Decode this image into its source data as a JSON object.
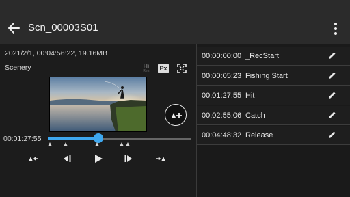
{
  "header": {
    "title": "Scn_00003S01",
    "back_icon": "back-arrow-icon",
    "more_icon": "more-vert-icon"
  },
  "clip": {
    "info": "2021/2/1, 00:04:56:22,  19.16MB",
    "scene": "Scenery",
    "badges": {
      "hi": "Hi",
      "hi_sub": "Res",
      "px": "Px"
    },
    "current_time": "00:01:27:55",
    "progress": 0.35
  },
  "essence_marks": [
    {
      "time": "00:00:00:00",
      "name": "_RecStart"
    },
    {
      "time": "00:00:05:23",
      "name": "Fishing Start"
    },
    {
      "time": "00:01:27:55",
      "name": "Hit"
    },
    {
      "time": "00:02:55:06",
      "name": "Catch"
    },
    {
      "time": "00:04:48:32",
      "name": "Release"
    }
  ],
  "colors": {
    "accent": "#3ea8f0",
    "background": "#1a1a1a",
    "appbar": "#2b2b2b"
  }
}
